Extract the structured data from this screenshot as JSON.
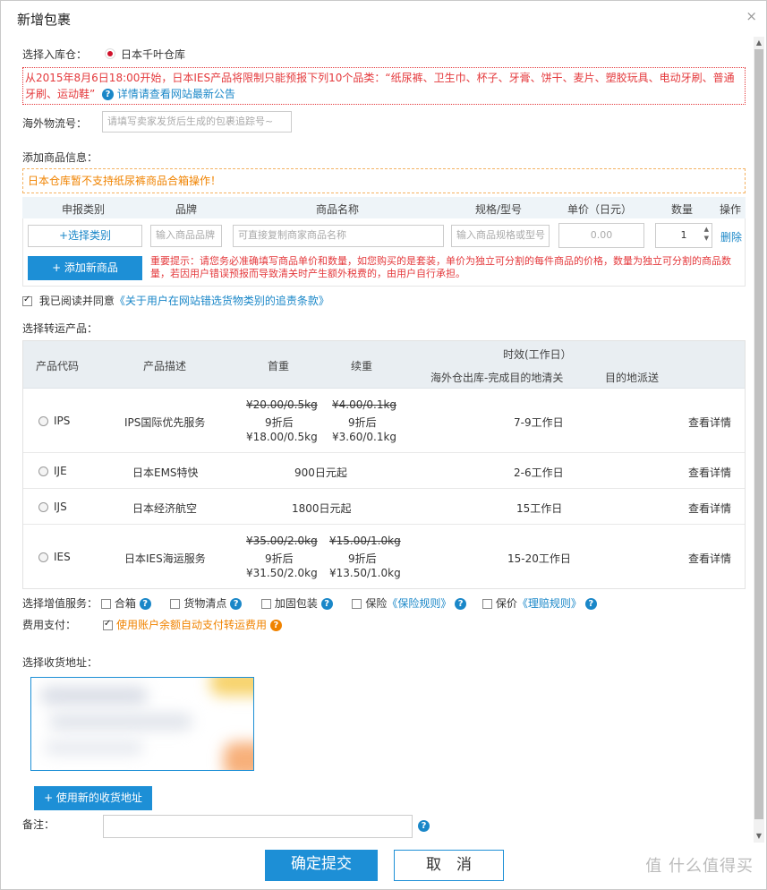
{
  "dialog": {
    "title": "新增包裹",
    "close": "×"
  },
  "warehouse": {
    "label": "选择入库仓：",
    "value": "日本千叶仓库"
  },
  "notice": {
    "text": "从2015年8月6日18:00开始，日本IES产品将限制只能预报下列10个品类：“纸尿裤、卫生巾、杯子、牙膏、饼干、麦片、塑胶玩具、电动牙刷、普通牙刷、运动鞋”",
    "link": "详情请查看网站最新公告"
  },
  "tracking": {
    "label": "海外物流号：",
    "placeholder": "请填写卖家发货后生成的包裹追踪号~"
  },
  "goods": {
    "label": "添加商品信息：",
    "warning": "日本仓库暂不支持纸尿裤商品合箱操作！",
    "headers": [
      "申报类别",
      "品牌",
      "商品名称",
      "规格/型号",
      "单价（日元）",
      "数量",
      "操作"
    ],
    "select_category": "+选择类别",
    "brand_placeholder": "输入商品品牌",
    "name_placeholder": "可直接复制商家商品名称",
    "spec_placeholder": "输入商品规格或型号",
    "price_value": "0.00",
    "qty_value": "1",
    "delete": "删除",
    "add_button": "+ 添加新商品",
    "tip": "重要提示：请您务必准确填写商品单价和数量，如您购买的是套装，单价为独立可分割的每件商品的价格，数量为独立可分割的商品数量，若因用户错误预报而导致清关时产生额外税费的，由用户自行承担。"
  },
  "agree": {
    "text": "我已阅读并同意",
    "link": "《关于用户在网站错选货物类别的追责条款》"
  },
  "transport": {
    "label": "选择转运产品：",
    "headers": {
      "code": "产品代码",
      "desc": "产品描述",
      "first": "首重",
      "extra": "续重",
      "time": "时效(工作日）",
      "time_sub1": "海外仓出库-完成目的地清关",
      "time_sub2": "目的地派送"
    },
    "rows": [
      {
        "code": "IPS",
        "desc": "IPS国际优先服务",
        "first_old": "¥20.00/0.5kg",
        "first_disc": "9折后",
        "first_new": "¥18.00/0.5kg",
        "extra_old": "¥4.00/0.1kg",
        "extra_disc": "9折后",
        "extra_new": "¥3.60/0.1kg",
        "time": "7-9工作日",
        "detail": "查看详情"
      },
      {
        "code": "IJE",
        "desc": "日本EMS特快",
        "price": "900日元起",
        "time": "2-6工作日",
        "detail": "查看详情"
      },
      {
        "code": "IJS",
        "desc": "日本经济航空",
        "price": "1800日元起",
        "time": "15工作日",
        "detail": "查看详情"
      },
      {
        "code": "IES",
        "desc": "日本IES海运服务",
        "first_old": "¥35.00/2.0kg",
        "first_disc": "9折后",
        "first_new": "¥31.50/2.0kg",
        "extra_old": "¥15.00/1.0kg",
        "extra_disc": "9折后",
        "extra_new": "¥13.50/1.0kg",
        "time": "15-20工作日",
        "detail": "查看详情"
      }
    ]
  },
  "services": {
    "label": "选择增值服务：",
    "items": [
      "合箱",
      "货物清点",
      "加固包装",
      "保险",
      "保价"
    ],
    "insurance_link": "《保险规则》",
    "valuation_link": "《理赔规则》"
  },
  "payment": {
    "label": "费用支付：",
    "text": "使用账户余额自动支付转运费用"
  },
  "address": {
    "label": "选择收货地址：",
    "new_button": "+ 使用新的收货地址"
  },
  "remark": {
    "label": "备注："
  },
  "actions": {
    "submit": "确定提交",
    "cancel": "取　消"
  },
  "watermark": "值 什么值得买",
  "colors": {
    "accent": "#1d8fd6",
    "warning": "#e4393c",
    "orange": "#f08300"
  }
}
